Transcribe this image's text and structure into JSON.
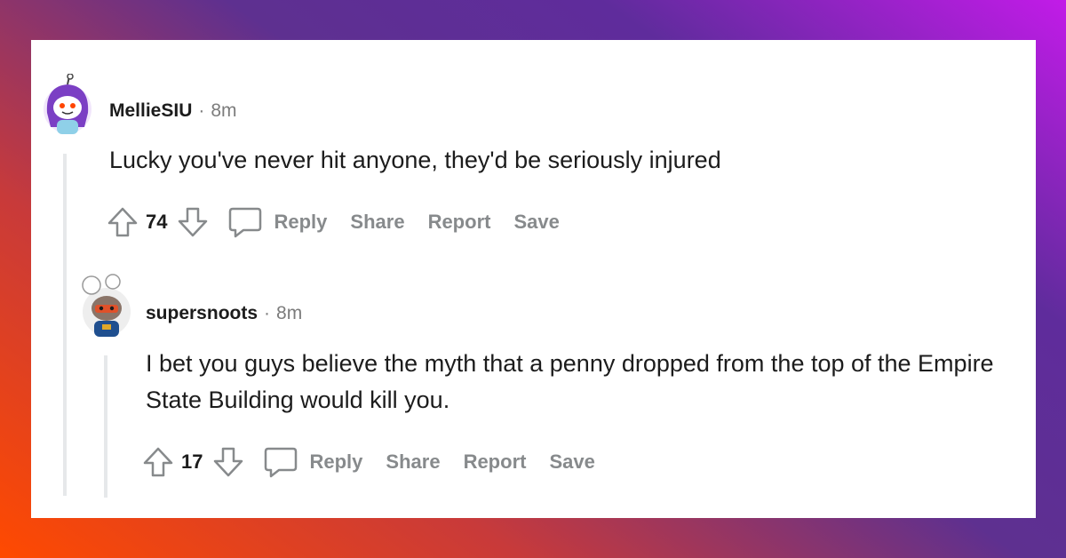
{
  "comments": [
    {
      "username": "MellieSIU",
      "separator": "·",
      "time": "8m",
      "body": "Lucky you've never hit anyone, they'd be seriously injured",
      "score": "74",
      "actions": {
        "reply": "Reply",
        "share": "Share",
        "report": "Report",
        "save": "Save"
      },
      "avatar_colors": {
        "hair": "#7b3fc4",
        "face": "#ffffff",
        "bg": "#f4e8ff"
      }
    },
    {
      "username": "supersnoots",
      "separator": "·",
      "time": "8m",
      "body": "I bet you guys believe the myth that a penny dropped from the top of the Empire State Building would kill you.",
      "score": "17",
      "actions": {
        "reply": "Reply",
        "share": "Share",
        "report": "Report",
        "save": "Save"
      },
      "avatar_colors": {
        "mask": "#e0512a",
        "body": "#1f4f8f",
        "bg": "#f2f2f2"
      }
    }
  ],
  "icons": {
    "upvote": "upvote-arrow-icon",
    "downvote": "downvote-arrow-icon",
    "comment": "speech-bubble-icon"
  },
  "colors": {
    "text": "#1c1c1c",
    "meta": "#7c7c7c",
    "action": "#878a8c",
    "thread_line": "#e6e8ea"
  }
}
